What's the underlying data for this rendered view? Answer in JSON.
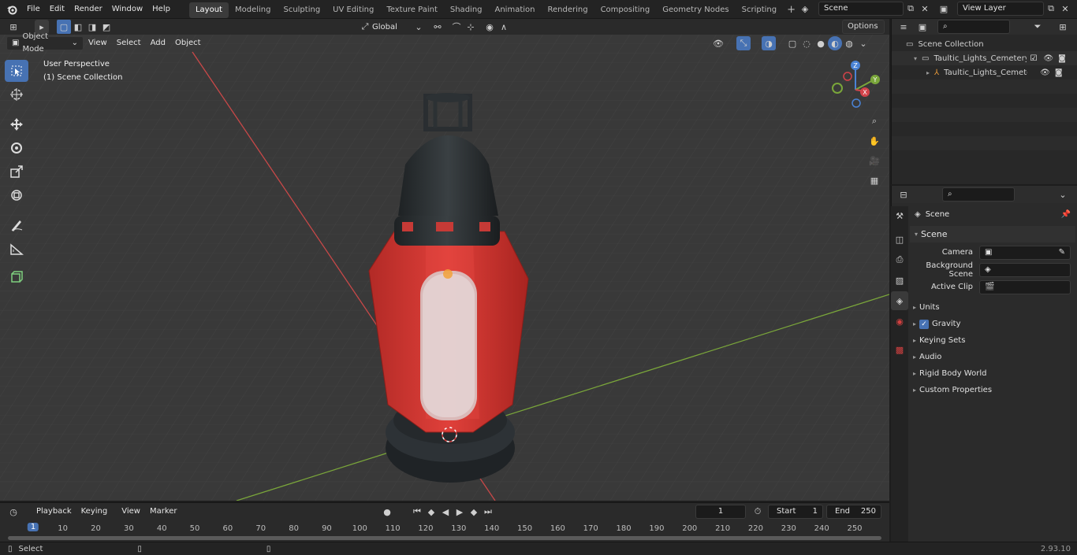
{
  "topbar": {
    "menus": [
      "File",
      "Edit",
      "Render",
      "Window",
      "Help"
    ],
    "workspaces": [
      "Layout",
      "Modeling",
      "Sculpting",
      "UV Editing",
      "Texture Paint",
      "Shading",
      "Animation",
      "Rendering",
      "Compositing",
      "Geometry Nodes",
      "Scripting"
    ],
    "active_workspace": "Layout",
    "scene_name": "Scene",
    "view_layer": "View Layer"
  },
  "viewport_header": {
    "mode": "Object Mode",
    "menus": [
      "View",
      "Select",
      "Add",
      "Object"
    ],
    "orientation": "Global",
    "options_label": "Options"
  },
  "viewport": {
    "perspective_label": "User Perspective",
    "collection_label": "(1) Scene Collection",
    "axis_x_color": "#c84848",
    "axis_y_color": "#7aa63a",
    "selection_color": "#4772b3"
  },
  "outliner": {
    "root": "Scene Collection",
    "items": [
      {
        "label": "Taultic_Lights_Cemetery_Mer"
      },
      {
        "label": "Taultic_Lights_Cemetery_"
      }
    ]
  },
  "properties": {
    "header": "Scene",
    "section": "Scene",
    "fields": [
      {
        "label": "Camera"
      },
      {
        "label": "Background Scene"
      },
      {
        "label": "Active Clip"
      }
    ],
    "panels": [
      "Units",
      "Gravity",
      "Keying Sets",
      "Audio",
      "Rigid Body World",
      "Custom Properties"
    ]
  },
  "timeline": {
    "menus": [
      "Playback",
      "Keying",
      "View",
      "Marker"
    ],
    "current_frame": "1",
    "start_label": "Start",
    "start_value": "1",
    "end_label": "End",
    "end_value": "250",
    "ticks": [
      "1",
      "10",
      "20",
      "30",
      "40",
      "50",
      "60",
      "70",
      "80",
      "90",
      "100",
      "110",
      "120",
      "130",
      "140",
      "150",
      "160",
      "170",
      "180",
      "190",
      "200",
      "210",
      "220",
      "230",
      "240",
      "250"
    ]
  },
  "statusbar": {
    "left_label": "Select",
    "version": "2.93.10"
  }
}
